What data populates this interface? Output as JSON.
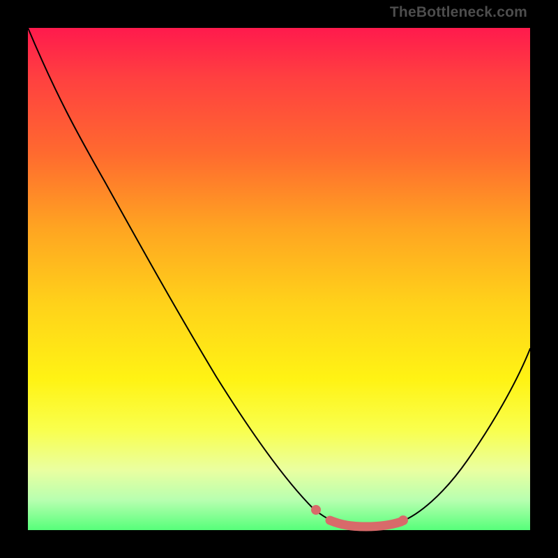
{
  "attribution": "TheBottleneck.com",
  "colors": {
    "frame": "#000000",
    "gradient_top": "#ff1a4d",
    "gradient_mid1": "#ffa521",
    "gradient_mid2": "#fff314",
    "gradient_bottom": "#56ff7a",
    "curve": "#000000",
    "marker": "#d86a6a"
  },
  "chart_data": {
    "type": "line",
    "title": "",
    "xlabel": "",
    "ylabel": "",
    "xlim": [
      0,
      100
    ],
    "ylim": [
      0,
      100
    ],
    "grid": false,
    "legend": false,
    "series": [
      {
        "name": "bottleneck-curve",
        "x": [
          0,
          10,
          20,
          30,
          40,
          50,
          55,
          60,
          62,
          65,
          70,
          75,
          80,
          90,
          100
        ],
        "values": [
          100,
          82,
          64,
          47,
          30,
          15,
          8,
          3,
          2,
          2,
          2,
          4,
          9,
          25,
          45
        ]
      },
      {
        "name": "optimal-range-marker",
        "x": [
          60,
          62,
          65,
          70,
          75
        ],
        "values": [
          3,
          2,
          2,
          2,
          4
        ]
      }
    ],
    "annotations": []
  }
}
